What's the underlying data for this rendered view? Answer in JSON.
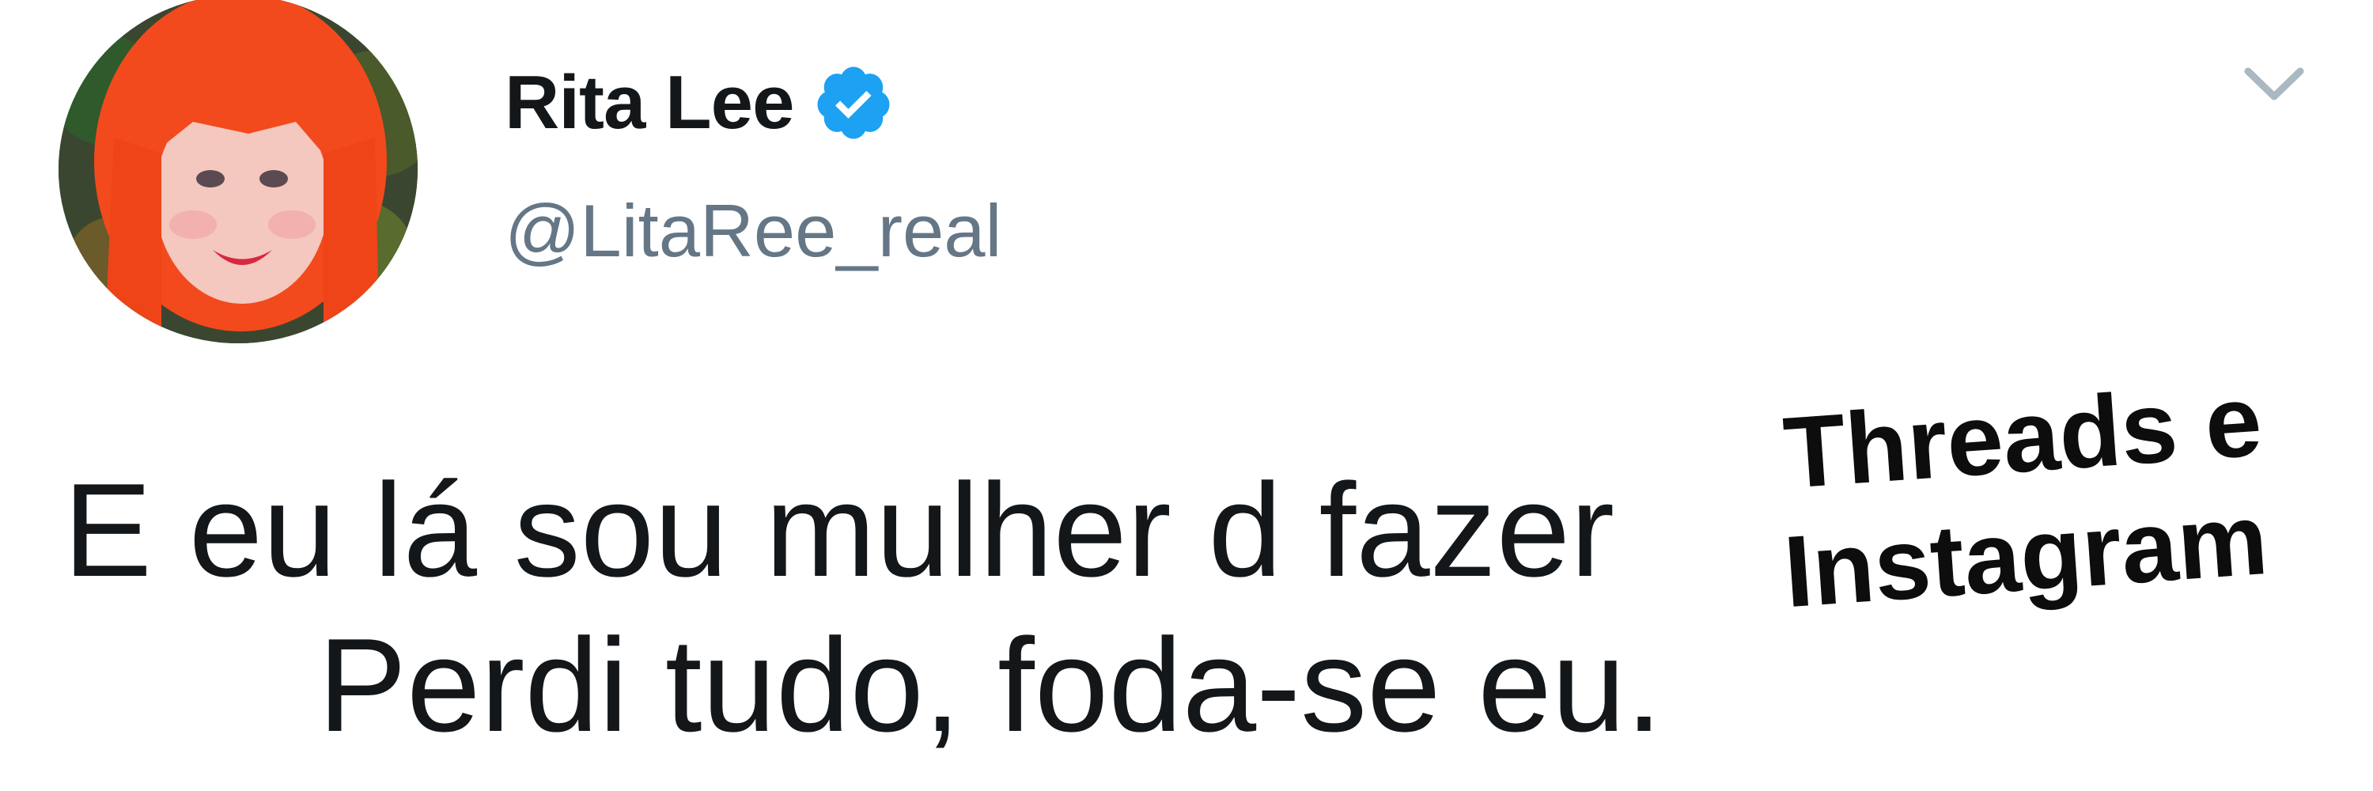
{
  "tweet": {
    "author": {
      "display_name": "Rita Lee",
      "handle": "@LitaRee_real",
      "verified": true,
      "avatar_icon": "avatar-red-hair-portrait"
    },
    "menu_icon": "chevron-down-icon",
    "text_lines": [
      "E eu lá sou mulher d fazer",
      "Perdi tudo, foda-se eu."
    ],
    "overlay_lines": [
      "Threads e",
      "Instagram"
    ]
  },
  "colors": {
    "verified_blue": "#1da1f2",
    "handle_gray": "#657786",
    "text": "#14171a",
    "caret_gray": "#aab8c2",
    "hair_orange": "#f2461e"
  }
}
